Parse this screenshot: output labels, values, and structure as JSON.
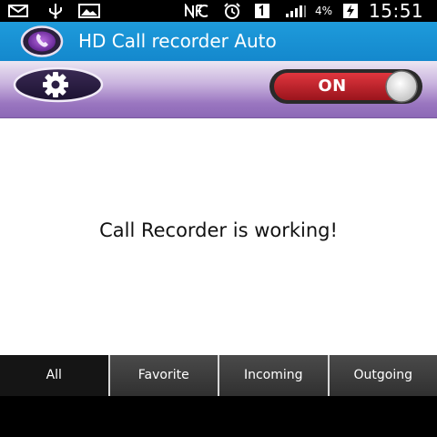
{
  "status_bar": {
    "icons": [
      "mail-icon",
      "usb-icon",
      "image-icon",
      "nfc-icon",
      "alarm-icon",
      "sim-1-icon",
      "signal-icon",
      "battery-charging-icon"
    ],
    "battery_percent": "4%",
    "time": "15:51"
  },
  "app": {
    "title": "HD Call recorder Auto",
    "logo_icon": "app-logo-icon"
  },
  "controls": {
    "settings_icon": "gear-icon",
    "toggle_label": "ON",
    "toggle_state": "on"
  },
  "main": {
    "message": "Call Recorder is working!"
  },
  "tabs": [
    {
      "label": "All",
      "active": true
    },
    {
      "label": "Favorite",
      "active": false
    },
    {
      "label": "Incoming",
      "active": false
    },
    {
      "label": "Outgoing",
      "active": false
    }
  ],
  "colors": {
    "action_bar": "#1488cd",
    "band_purple": "#8c68b6",
    "toggle_red": "#c8242c",
    "tab_active": "#151515",
    "tab_inactive": "#3c3c3c"
  }
}
